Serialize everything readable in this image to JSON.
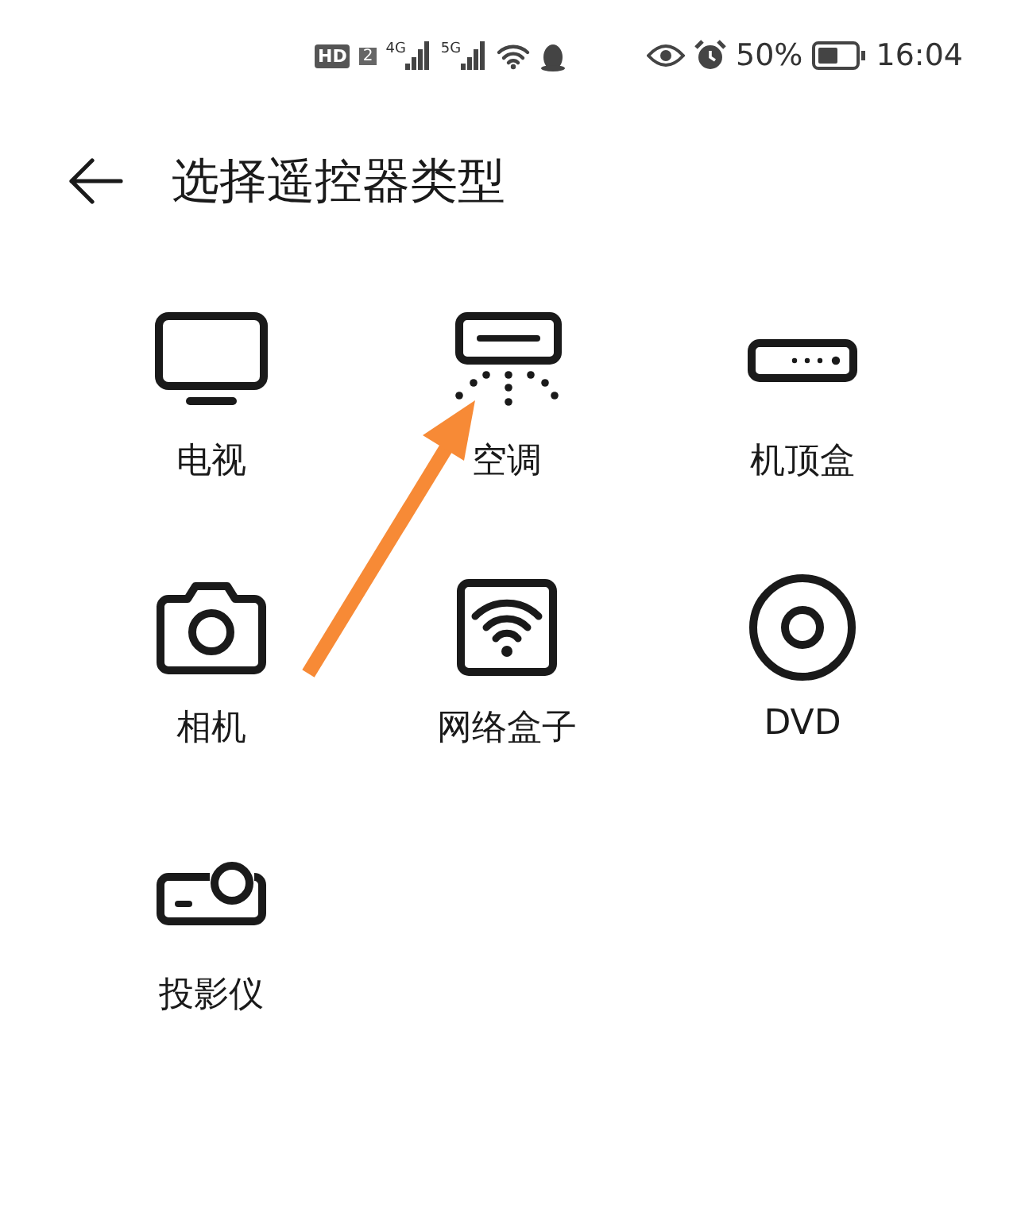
{
  "status_bar": {
    "hd": "HD",
    "sim": "2",
    "networks": [
      "4G",
      "5G"
    ],
    "battery": "50%",
    "time": "16:04"
  },
  "header": {
    "title": "选择遥控器类型"
  },
  "devices": [
    {
      "label": "电视",
      "kind": "tv"
    },
    {
      "label": "空调",
      "kind": "ac"
    },
    {
      "label": "机顶盒",
      "kind": "stb"
    },
    {
      "label": "相机",
      "kind": "camera"
    },
    {
      "label": "网络盒子",
      "kind": "netbox"
    },
    {
      "label": "DVD",
      "kind": "dvd"
    },
    {
      "label": "投影仪",
      "kind": "projector"
    }
  ],
  "annotation": {
    "kind": "arrow"
  }
}
